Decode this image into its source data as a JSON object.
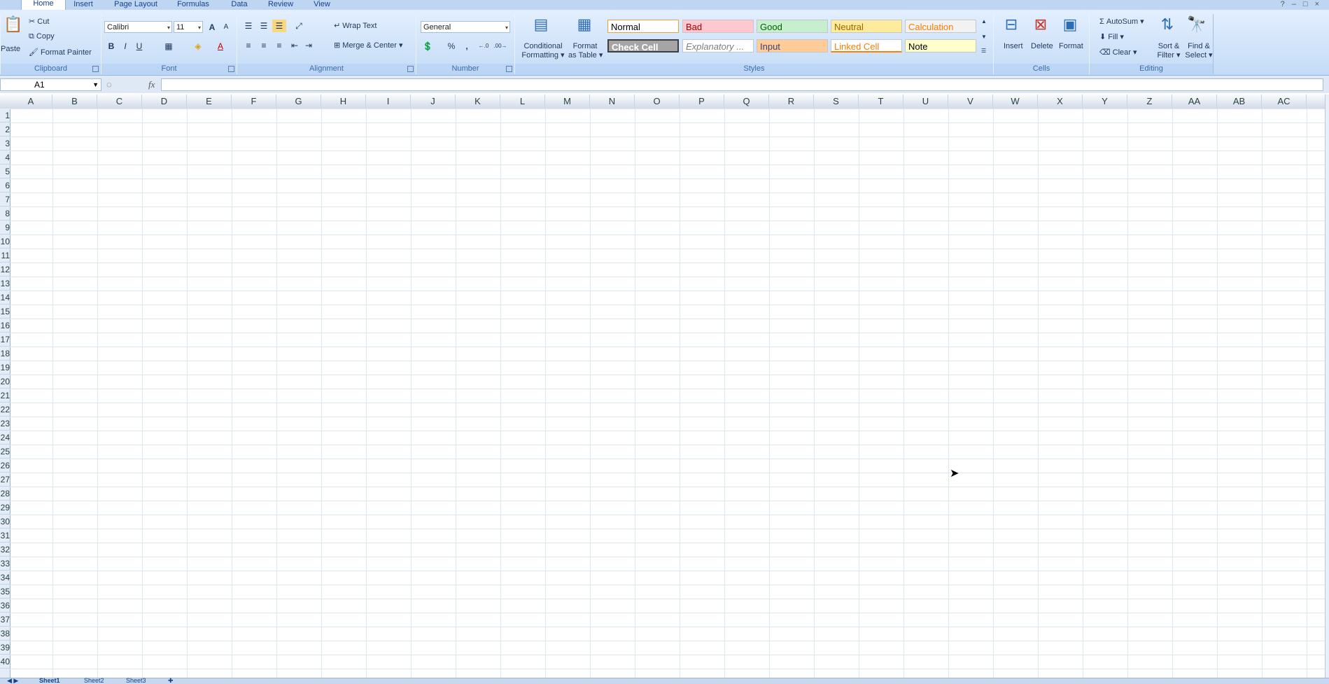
{
  "tabs": [
    {
      "label": "Home",
      "active": true
    },
    {
      "label": "Insert"
    },
    {
      "label": "Page Layout"
    },
    {
      "label": "Formulas"
    },
    {
      "label": "Data"
    },
    {
      "label": "Review"
    },
    {
      "label": "View"
    }
  ],
  "clipboard": {
    "title": "Clipboard",
    "paste": "Paste",
    "cut": "Cut",
    "copy": "Copy",
    "format_painter": "Format Painter"
  },
  "font": {
    "title": "Font",
    "name": "Calibri",
    "size": "11",
    "bold": "B",
    "italic": "I",
    "underline": "U",
    "grow": "A",
    "shrink": "A",
    "font_color": "A"
  },
  "alignment": {
    "title": "Alignment",
    "wrap_text": "Wrap Text",
    "merge_center": "Merge & Center"
  },
  "number": {
    "title": "Number",
    "format": "General",
    "percent": "%",
    "comma": ",",
    "inc_decimal": "+.0 .00",
    "dec_decimal": ".00 →.0"
  },
  "styles": {
    "title": "Styles",
    "conditional": "Conditional",
    "conditional2": "Formatting",
    "format_as": "Format",
    "format_as2": "as Table",
    "cells": [
      {
        "label": "Normal",
        "bg": "#ffffff",
        "fg": "#000000",
        "border": "#e8a33d"
      },
      {
        "label": "Bad",
        "bg": "#ffc7ce",
        "fg": "#9c0006"
      },
      {
        "label": "Good",
        "bg": "#c6efce",
        "fg": "#006100"
      },
      {
        "label": "Neutral",
        "bg": "#ffeb9c",
        "fg": "#9c6500"
      },
      {
        "label": "Calculation",
        "bg": "#f2f2f2",
        "fg": "#fa7d00"
      },
      {
        "label": "Check Cell",
        "bg": "#a5a5a5",
        "fg": "#ffffff"
      },
      {
        "label": "Explanatory ...",
        "bg": "#ffffff",
        "fg": "#7f7f7f"
      },
      {
        "label": "Input",
        "bg": "#ffcc99",
        "fg": "#3f3f76"
      },
      {
        "label": "Linked Cell",
        "bg": "#ffffff",
        "fg": "#fa7d00"
      },
      {
        "label": "Note",
        "bg": "#ffffcc",
        "fg": "#000000"
      }
    ]
  },
  "cells_group": {
    "title": "Cells",
    "insert": "Insert",
    "delete": "Delete",
    "format": "Format"
  },
  "editing": {
    "title": "Editing",
    "autosum": "AutoSum",
    "fill": "Fill",
    "clear": "Clear",
    "sort": "Sort &",
    "sort2": "Filter",
    "find": "Find &",
    "find2": "Select"
  },
  "namebox": "A1",
  "fx": "fx",
  "columns": [
    "A",
    "B",
    "C",
    "D",
    "E",
    "F",
    "G",
    "H",
    "I",
    "J",
    "K",
    "L",
    "M",
    "N",
    "O",
    "P",
    "Q",
    "R",
    "S",
    "T",
    "U",
    "V",
    "W",
    "X",
    "Y",
    "Z",
    "AA",
    "AB",
    "AC"
  ],
  "rows": [
    "1",
    "2",
    "3",
    "4",
    "5",
    "6",
    "7",
    "8",
    "9",
    "10",
    "11",
    "12",
    "13",
    "14",
    "15",
    "16",
    "17",
    "18",
    "19",
    "20",
    "21",
    "22",
    "23",
    "24",
    "25",
    "26",
    "27",
    "28",
    "29",
    "30",
    "31",
    "32",
    "33",
    "34",
    "35",
    "36",
    "37",
    "38",
    "39",
    "40"
  ],
  "sheets": [
    "Sheet1",
    "Sheet2",
    "Sheet3"
  ]
}
